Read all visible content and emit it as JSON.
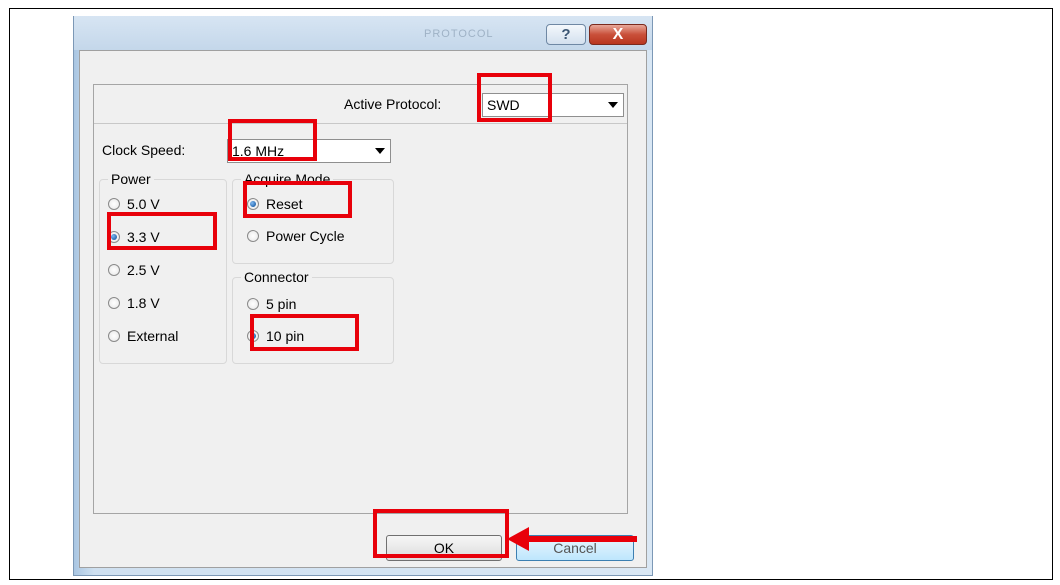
{
  "dialog": {
    "title_ghost": "PROTOCOL",
    "help_glyph": "?",
    "close_glyph": "X"
  },
  "protocol": {
    "label": "Active Protocol:",
    "value": "SWD"
  },
  "clock": {
    "label": "Clock Speed:",
    "value": "1.6 MHz"
  },
  "power": {
    "title": "Power",
    "options": [
      "5.0 V",
      "3.3 V",
      "2.5 V",
      "1.8 V",
      "External"
    ],
    "selected": "3.3 V"
  },
  "acquire": {
    "title": "Acquire Mode",
    "options": [
      "Reset",
      "Power Cycle"
    ],
    "selected": "Reset"
  },
  "connector": {
    "title": "Connector",
    "options": [
      "5 pin",
      "10 pin"
    ],
    "selected": "10 pin"
  },
  "buttons": {
    "ok": "OK",
    "cancel": "Cancel"
  },
  "colors": {
    "highlight": "#e8000a",
    "window_frame": "#c4d7ea"
  }
}
